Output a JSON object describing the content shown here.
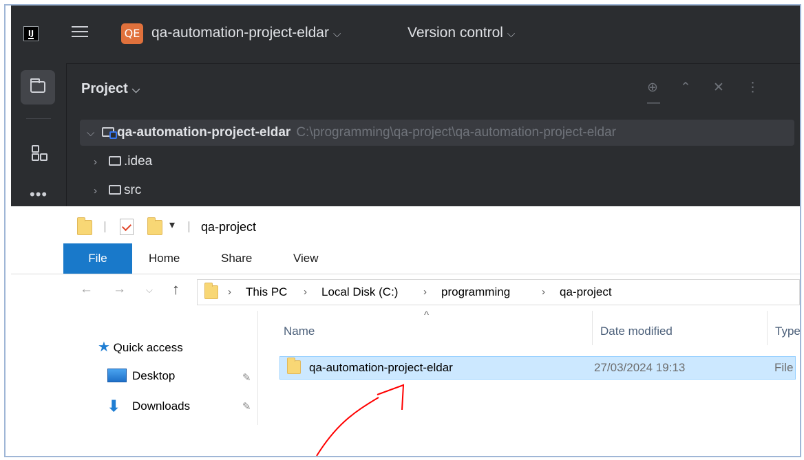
{
  "ide": {
    "logo": "IJ",
    "project_badge": "QE",
    "project_name": "qa-automation-project-eldar",
    "vcs_menu": "Version control",
    "panel_title": "Project",
    "tree": {
      "root_name": "qa-automation-project-eldar",
      "root_path": "C:\\programming\\qa-project\\qa-automation-project-eldar",
      "children": [
        ".idea",
        "src"
      ]
    }
  },
  "explorer": {
    "window_title": "qa-project",
    "ribbon_tabs": [
      "File",
      "Home",
      "Share",
      "View"
    ],
    "breadcrumb": [
      "This PC",
      "Local Disk (C:)",
      "programming",
      "qa-project"
    ],
    "nav_pane": {
      "quick_access": "Quick access",
      "items": [
        "Desktop",
        "Downloads"
      ]
    },
    "columns": [
      "Name",
      "Date modified",
      "Type"
    ],
    "rows": [
      {
        "name": "qa-automation-project-eldar",
        "date": "27/03/2024 19:13",
        "type": "File folder"
      }
    ]
  },
  "colors": {
    "ide_bg": "#2b2d30",
    "project_badge": "#e0713c",
    "ribbon_file": "#1979ca",
    "selection": "#cce8ff",
    "annotation_arrow": "#ff0000"
  }
}
